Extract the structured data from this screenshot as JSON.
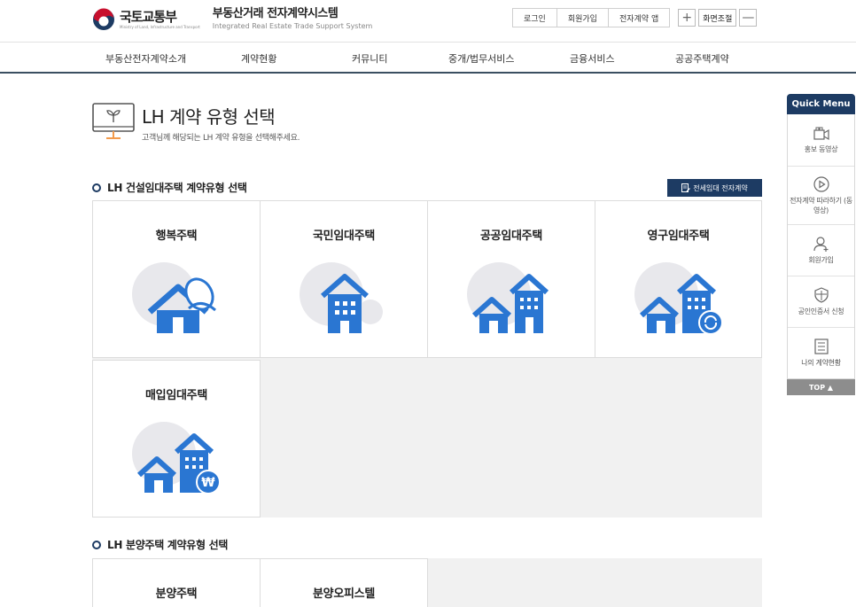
{
  "header": {
    "ministry_name": "국토교통부",
    "ministry_en": "Ministry of Land, Infrastructure and Transport",
    "system_name": "부동산거래 전자계약시스템",
    "system_en": "Integrated Real Estate Trade Support System",
    "util": {
      "login": "로그인",
      "signup": "회원가입",
      "app": "전자계약 앱"
    },
    "zoom": {
      "plus": "+",
      "label": "화면조절",
      "minus": "—"
    }
  },
  "nav": {
    "items": [
      "부동산전자계약소개",
      "계약현황",
      "커뮤니티",
      "중개/법무서비스",
      "금융서비스",
      "공공주택계약"
    ]
  },
  "page": {
    "title": "LH 계약 유형 선택",
    "subtitle": "고객님께 해당되는 LH 계약 유형을 선택해주세요."
  },
  "rental_section": {
    "heading": "LH 건설임대주택 계약유형 선택",
    "jeonse_button": "전세임대 전자계약",
    "cards": [
      {
        "label": "행복주택",
        "icon": "house-leaf-icon"
      },
      {
        "label": "국민임대주택",
        "icon": "apartment-icon"
      },
      {
        "label": "공공임대주택",
        "icon": "house-apartment-icon"
      },
      {
        "label": "영구임대주택",
        "icon": "house-apartment-refresh-icon"
      },
      {
        "label": "매입임대주택",
        "icon": "house-apartment-won-icon"
      }
    ]
  },
  "sale_section": {
    "heading": "LH 분양주택 계약유형 선택",
    "cards": [
      {
        "label": "분양주택"
      },
      {
        "label": "분양오피스텔"
      }
    ]
  },
  "quick_menu": {
    "title": "Quick Menu",
    "items": [
      {
        "label": "홍보 동영상",
        "icon": "video-camera-icon"
      },
      {
        "label": "전자계약 따라하기 (동영상)",
        "icon": "play-circle-icon"
      },
      {
        "label": "회원가입",
        "icon": "user-add-icon"
      },
      {
        "label": "공인인증서 신청",
        "icon": "shield-icon"
      },
      {
        "label": "나의 계약현황",
        "icon": "document-list-icon"
      }
    ],
    "top": "TOP ▲"
  },
  "colors": {
    "primary": "#1d3b63",
    "icon_blue": "#2a76d2",
    "icon_circle": "#e8e8ec",
    "nav_border": "#3b4f61",
    "title_icon_accent": "#f39a4b"
  }
}
